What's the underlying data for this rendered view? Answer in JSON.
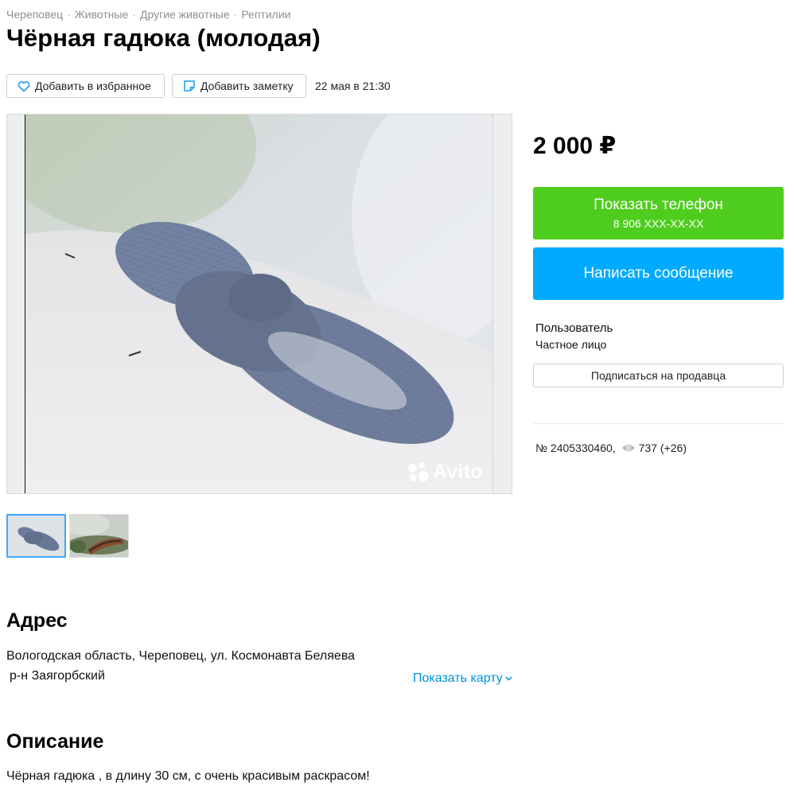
{
  "breadcrumbs": [
    "Череповец",
    "Животные",
    "Другие животные",
    "Рептилии"
  ],
  "breadcrumb_separator": "·",
  "title": "Чёрная гадюка (молодая)",
  "toolbar": {
    "favorite_label": "Добавить в избранное",
    "note_label": "Добавить заметку",
    "date": "22 мая в 21:30"
  },
  "gallery": {
    "watermark": "Avito",
    "thumbnail_count": 2
  },
  "sidebar": {
    "price": "2 000 ₽",
    "phone_button": {
      "label": "Показать телефон",
      "number": "8 906 XXX-XX-XX"
    },
    "message_button": "Написать сообщение",
    "seller_name": "Пользователь",
    "seller_type": "Частное лицо",
    "subscribe_button": "Подписаться на продавца",
    "ad_number": "№ 2405330460,",
    "views": "737 (+26)"
  },
  "address": {
    "heading": "Адрес",
    "line1": "Вологодская область, Череповец, ул. Космонавта Беляева",
    "line2": "р-н Заягорбский",
    "map_link": "Показать карту"
  },
  "description": {
    "heading": "Описание",
    "text": "Чёрная гадюка , в длину 30 см, с очень красивым раскрасом!"
  },
  "colors": {
    "phone_button": "#4fcd1e",
    "message_button": "#00aaff",
    "link": "#0091d9",
    "breadcrumb": "#8f8f8f"
  },
  "icons": {
    "favorite": "heart-icon",
    "note": "note-icon",
    "views": "eye-icon",
    "map": "chevron-down-icon"
  }
}
